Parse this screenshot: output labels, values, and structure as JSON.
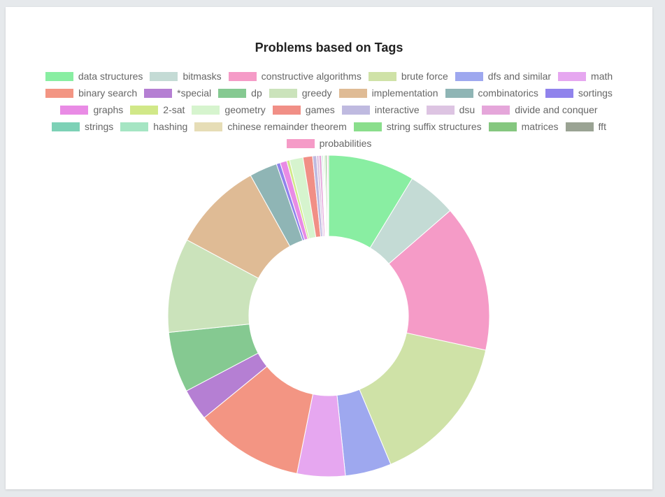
{
  "chart_data": {
    "type": "pie",
    "variant": "doughnut",
    "title": "Problems based on Tags",
    "legend_position": "top",
    "categories": [
      "data structures",
      "bitmasks",
      "constructive algorithms",
      "brute force",
      "dfs and similar",
      "math",
      "binary search",
      "*special",
      "dp",
      "greedy",
      "implementation",
      "combinatorics",
      "sortings",
      "graphs",
      "2-sat",
      "geometry",
      "games",
      "interactive",
      "dsu",
      "divide and conquer",
      "strings",
      "hashing",
      "chinese remainder theorem",
      "string suffix structures",
      "matrices",
      "fft",
      "probabilities"
    ],
    "values": [
      9.0,
      5.1,
      15.3,
      15.8,
      4.8,
      5.0,
      11.3,
      3.3,
      6.3,
      9.8,
      9.4,
      2.9,
      0.4,
      0.7,
      0.3,
      1.4,
      1.0,
      0.4,
      0.25,
      0.25,
      0.1,
      0.1,
      0.1,
      0.1,
      0.15,
      0.1,
      0.1
    ],
    "colors": [
      "#89eea2",
      "#c4dbd5",
      "#f59bc7",
      "#cfe2a7",
      "#9ea8ef",
      "#e6a7f0",
      "#f39583",
      "#b57fd3",
      "#85c991",
      "#cbe3bb",
      "#dfbb95",
      "#8fb5b5",
      "#9083ec",
      "#e98be5",
      "#d1e888",
      "#d6f4ce",
      "#f18f86",
      "#bfbae0",
      "#ddc4e2",
      "#e5a6da",
      "#7dd1b6",
      "#a5e5c3",
      "#e6ddb6",
      "#8ade8c",
      "#85c77f",
      "#9aa393",
      "#f59bc7"
    ]
  }
}
